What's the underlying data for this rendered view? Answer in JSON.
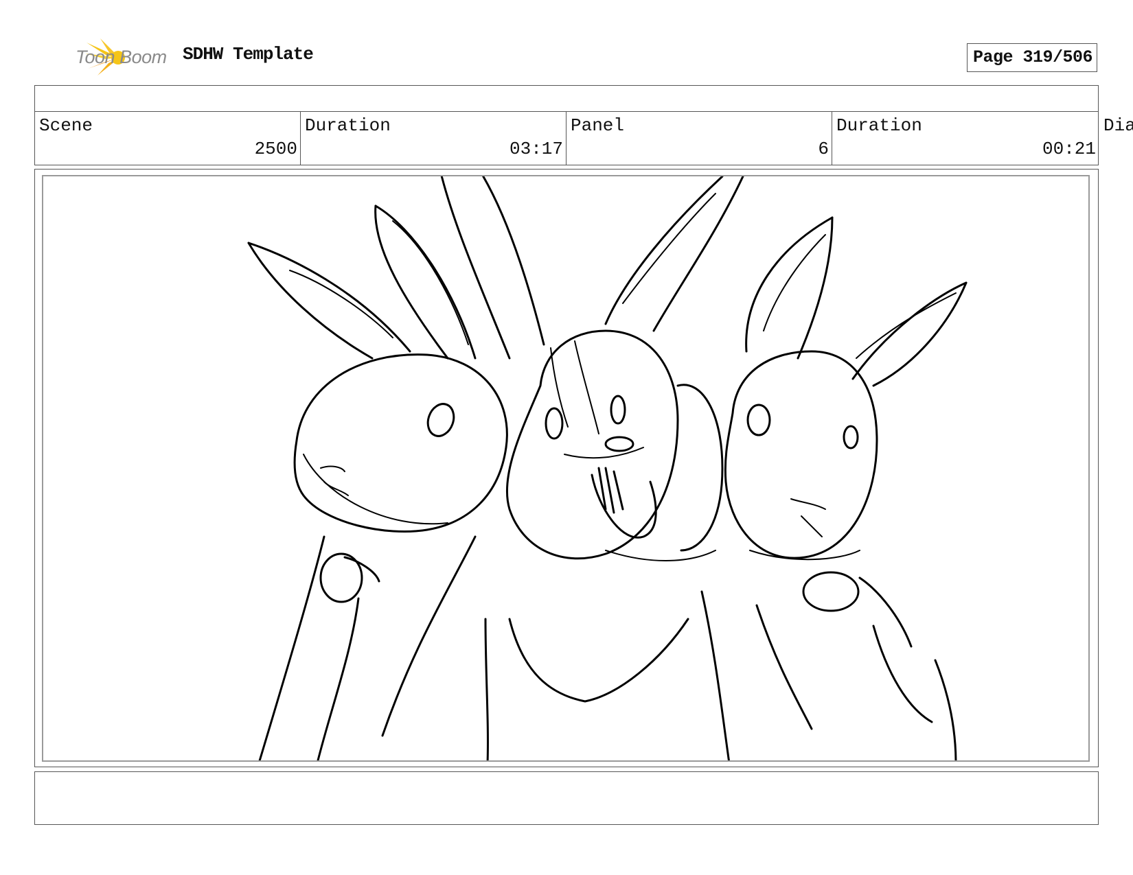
{
  "header": {
    "logo_text": "Toon Boom",
    "title": "SDHW Template",
    "page_label": "Page 319/506"
  },
  "info": {
    "scene_label": "Scene",
    "scene_value": "2500",
    "scene_duration_label": "Duration",
    "scene_duration_value": "03:17",
    "panel_label": "Panel",
    "panel_value": "6",
    "panel_duration_label": "Duration",
    "panel_duration_value": "00:21",
    "dialogue_label": "Dia"
  },
  "panel_image": {
    "icon": "storyboard-sketch-three-rabbits"
  },
  "colors": {
    "logo_yellow": "#f5c518",
    "logo_orange": "#f29a1e",
    "border": "#555555",
    "inner_frame": "#9a9a9a"
  }
}
